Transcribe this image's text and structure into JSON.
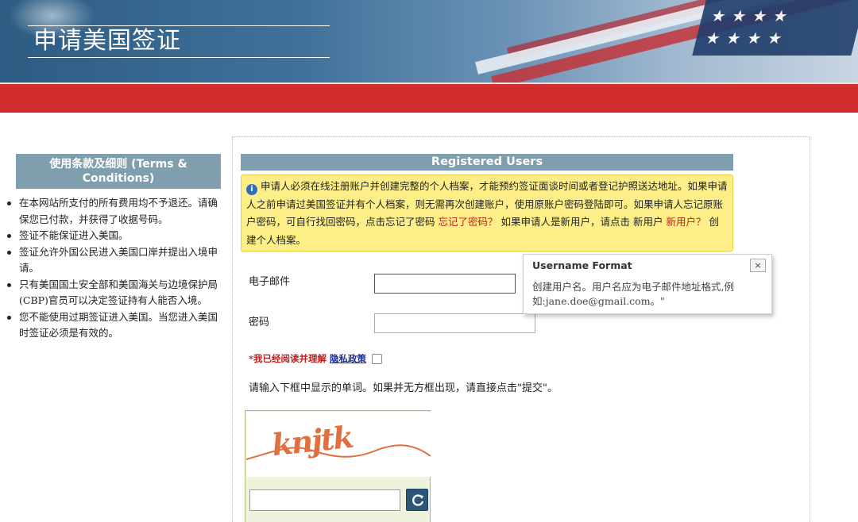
{
  "header": {
    "site_title": "申请美国签证"
  },
  "sidebar": {
    "heading": "使用条款及细则 (Terms & Conditions)",
    "items": [
      "在本网站所支付的所有费用均不予退还。请确保您已付款，并获得了收据号码。",
      "签证不能保证进入美国。",
      "签证允许外国公民进入美国口岸并提出入境申请。",
      "只有美国国土安全部和美国海关与边境保护局(CBP)官员可以决定签证持有人能否入境。",
      "您不能使用过期签证进入美国。当您进入美国时签证必须是有效的。"
    ]
  },
  "main": {
    "heading": "Registered Users",
    "info": {
      "icon": "info-icon",
      "text_1": "申请人必须在线注册账户并创建完整的个人档案，才能预约签证面谈时间或者登记护照送达地址。如果申请人之前申请过美国签证并有个人档案，则无需再次创建账户，使用原账户密码登陆即可。如果申请人忘记原账户密码，可自行找回密码，点击忘记了密码",
      "forgot_link": "忘记了密码？",
      "text_2": "如果申请人是新用户，请点击 新用户",
      "new_user_link": "新用户？",
      "text_3": "创建个人档案。"
    },
    "email_label": "电子邮件",
    "email_value": "",
    "password_label": "密码",
    "password_value": "",
    "policy": {
      "required_mark": "*我已经阅读并理解",
      "link": "隐私政策",
      "checked": false
    },
    "captcha_instruction": "请输入下框中显示的单词。如果并无方框出现，请直接点击\"提交\"。",
    "captcha_word": "knjtk",
    "captcha_value": ""
  },
  "tooltip": {
    "title": "Username Format",
    "close_label": "×",
    "body": "创建用户名。用户名应为电子邮件地址格式,例如:jane.doe@gmail.com。\""
  },
  "colors": {
    "header_blue": "#3f719a",
    "red_bar": "#d12d2d",
    "section_header": "#7f9eae",
    "info_yellow": "#fdee88",
    "link_red": "#c0201f"
  }
}
